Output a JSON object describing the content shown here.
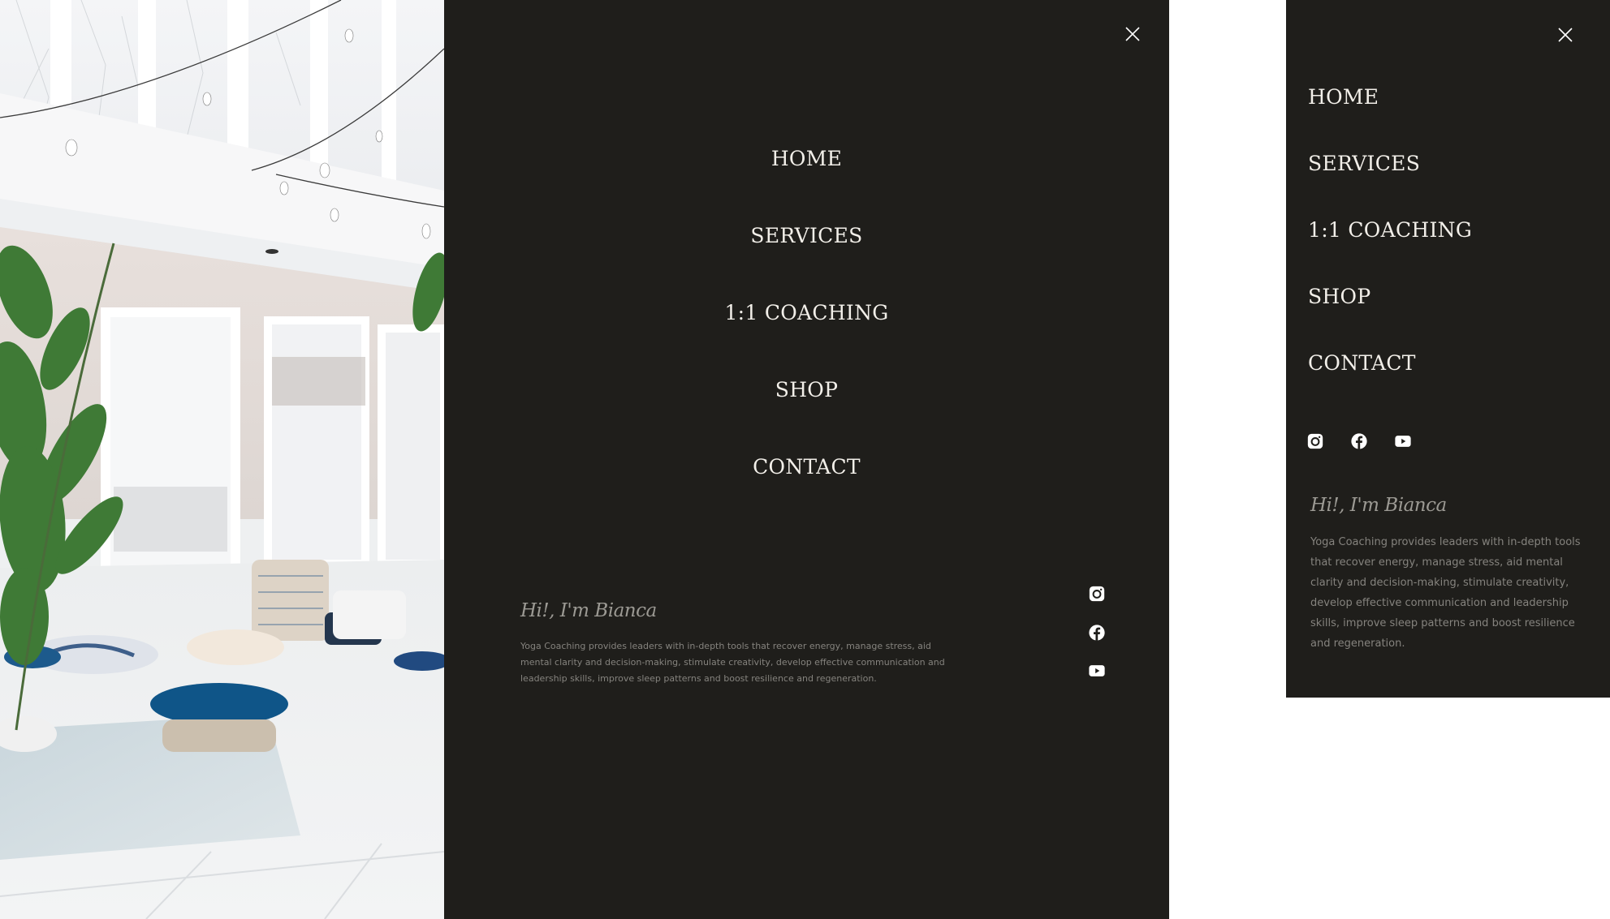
{
  "photo": {
    "description": "Bright yoga studio with large windows, string lights, plants and floor cushions"
  },
  "colors": {
    "panel_bg": "#1f1e1b",
    "nav_text": "#f2efe9",
    "bio_heading": "#9c9a94",
    "bio_text": "#85837e",
    "icon": "#ffffff"
  },
  "desktop_menu": {
    "close_icon": "close-icon",
    "nav_items": [
      {
        "label": "HOME"
      },
      {
        "label": "SERVICES"
      },
      {
        "label": "1:1 COACHING"
      },
      {
        "label": "SHOP"
      },
      {
        "label": "CONTACT"
      }
    ],
    "bio": {
      "heading": "Hi!, I'm Bianca",
      "text": "Yoga Coaching provides leaders with in-depth tools that recover energy, manage stress, aid mental clarity and decision-making, stimulate creativity, develop effective communication and leadership skills, improve sleep patterns and boost resilience and regeneration."
    },
    "social": [
      {
        "name": "instagram",
        "icon": "instagram-icon"
      },
      {
        "name": "facebook",
        "icon": "facebook-icon"
      },
      {
        "name": "youtube",
        "icon": "youtube-icon"
      }
    ]
  },
  "mobile_menu": {
    "close_icon": "close-icon",
    "nav_items": [
      {
        "label": "HOME"
      },
      {
        "label": "SERVICES"
      },
      {
        "label": "1:1 COACHING"
      },
      {
        "label": "SHOP"
      },
      {
        "label": "CONTACT"
      }
    ],
    "social": [
      {
        "name": "instagram",
        "icon": "instagram-icon"
      },
      {
        "name": "facebook",
        "icon": "facebook-icon"
      },
      {
        "name": "youtube",
        "icon": "youtube-icon"
      }
    ],
    "bio": {
      "heading": "Hi!, I'm Bianca",
      "text": "Yoga Coaching provides leaders with in-depth tools that recover energy, manage stress, aid mental clarity and decision-making, stimulate creativity, develop effective communication and leadership skills, improve sleep patterns and boost resilience and regeneration."
    }
  }
}
